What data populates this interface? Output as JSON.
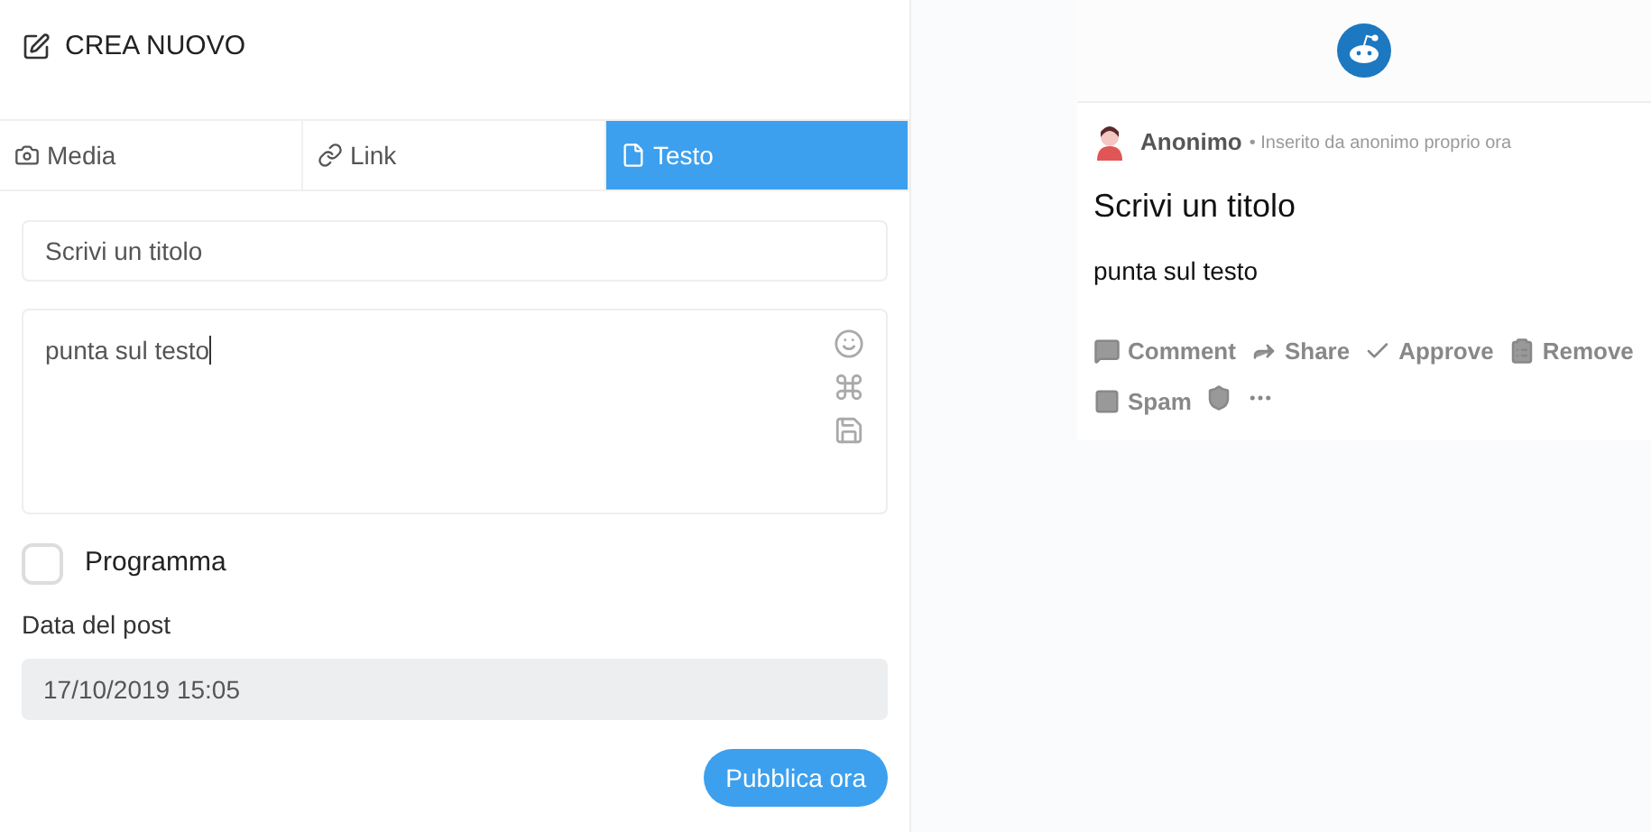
{
  "header": {
    "title": "CREA NUOVO"
  },
  "tabs": [
    {
      "label": "Media",
      "kind": "camera",
      "selected": false
    },
    {
      "label": "Link",
      "kind": "link",
      "selected": false
    },
    {
      "label": "Testo",
      "kind": "file",
      "selected": true
    }
  ],
  "title_field": {
    "placeholder": "Scrivi un titolo"
  },
  "body_field": {
    "value": "punta sul testo"
  },
  "schedule": {
    "label": "Programma",
    "checked": false
  },
  "date": {
    "label": "Data del post",
    "value": "17/10/2019 15:05",
    "disabled": true
  },
  "publish_button": "Pubblica ora",
  "preview": {
    "author": "Anonimo",
    "meta": "• Inserito da anonimo proprio ora",
    "title": "Scrivi un titolo",
    "body": "punta sul testo",
    "actions": [
      {
        "kind": "comment",
        "label": "Comment"
      },
      {
        "kind": "share",
        "label": "Share"
      },
      {
        "kind": "approve",
        "label": "Approve"
      },
      {
        "kind": "remove",
        "label": "Remove"
      },
      {
        "kind": "spam",
        "label": "Spam"
      },
      {
        "kind": "shield"
      },
      {
        "kind": "more"
      }
    ]
  }
}
